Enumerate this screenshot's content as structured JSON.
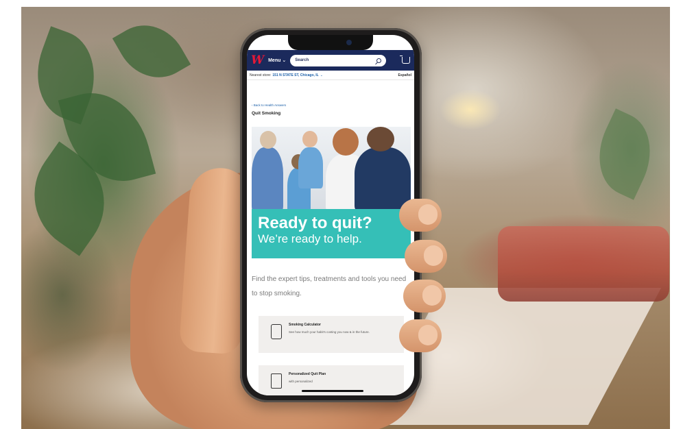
{
  "app": {
    "logo_text": "W",
    "menu_label": "Menu",
    "search_placeholder": "Search"
  },
  "store": {
    "label": "Nearest store:",
    "name": "151 N STATE ST, Chicago, IL",
    "language_link": "Español"
  },
  "page": {
    "back_link": "‹ Back to Health Answers",
    "title": "Quit Smoking",
    "hero_headline": "Ready to quit?",
    "hero_sub": "We’re ready to help.",
    "intro": "Find the expert tips, treatments and tools you need to stop smoking."
  },
  "cards": [
    {
      "title": "Smoking Calculator",
      "description": "See how much your habit's costing you now & in the future.",
      "icon": "calculator-icon"
    },
    {
      "title": "Personalized Quit Plan",
      "description": "with personalized",
      "icon": "clipboard-check-icon"
    }
  ],
  "colors": {
    "brand_navy": "#1b2a5c",
    "brand_red": "#e31837",
    "hero_teal": "#35bfb7"
  }
}
